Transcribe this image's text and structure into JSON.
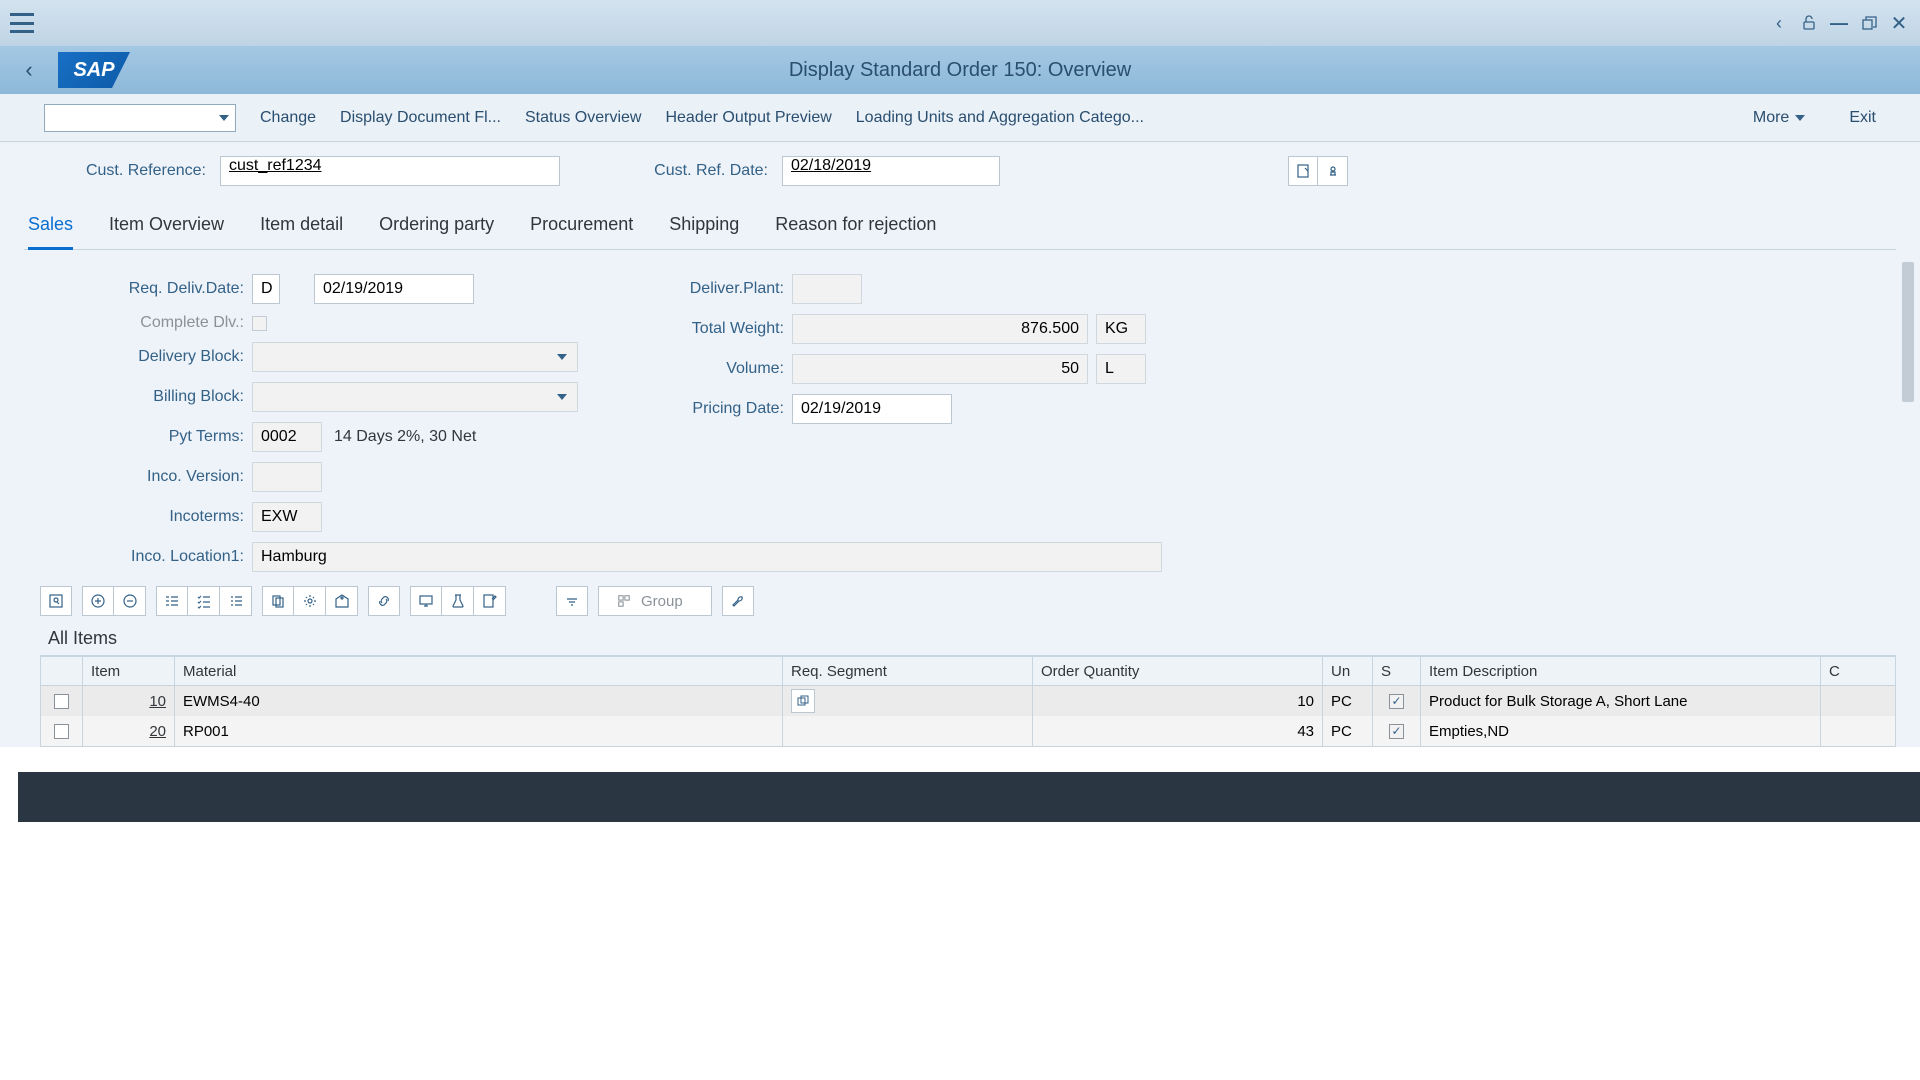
{
  "header": {
    "title": "Display Standard Order 150: Overview"
  },
  "actions": {
    "change": "Change",
    "docflow": "Display Document Fl...",
    "status": "Status Overview",
    "output": "Header Output Preview",
    "loading": "Loading Units and Aggregation Catego...",
    "more": "More",
    "exit": "Exit"
  },
  "cust": {
    "ref_label": "Cust. Reference:",
    "ref_value": "cust_ref1234",
    "date_label": "Cust. Ref. Date:",
    "date_value": "02/18/2019"
  },
  "tabs": {
    "sales": "Sales",
    "item_overview": "Item Overview",
    "item_detail": "Item detail",
    "ordering": "Ordering party",
    "procurement": "Procurement",
    "shipping": "Shipping",
    "rejection": "Reason for rejection"
  },
  "form": {
    "left": {
      "req_deliv_label": "Req. Deliv.Date:",
      "req_deliv_code": "D",
      "req_deliv_date": "02/19/2019",
      "complete_dlv_label": "Complete Dlv.:",
      "delivery_block_label": "Delivery Block:",
      "billing_block_label": "Billing Block:",
      "pyt_terms_label": "Pyt Terms:",
      "pyt_terms_code": "0002",
      "pyt_terms_desc": "14 Days 2%, 30 Net",
      "inco_version_label": "Inco. Version:",
      "incoterms_label": "Incoterms:",
      "incoterms_value": "EXW",
      "inco_loc_label": "Inco. Location1:",
      "inco_loc_value": "Hamburg"
    },
    "right": {
      "plant_label": "Deliver.Plant:",
      "weight_label": "Total Weight:",
      "weight_value": "876.500",
      "weight_unit": "KG",
      "volume_label": "Volume:",
      "volume_value": "50",
      "volume_unit": "L",
      "pricing_label": "Pricing Date:",
      "pricing_value": "02/19/2019"
    }
  },
  "toolbar": {
    "group_label": "Group"
  },
  "section": {
    "title": "All Items"
  },
  "table": {
    "headers": {
      "item": "Item",
      "material": "Material",
      "segment": "Req. Segment",
      "qty": "Order Quantity",
      "unit": "Un",
      "s": "S",
      "desc": "Item Description",
      "last": "C"
    },
    "rows": [
      {
        "item": "10",
        "material": "EWMS4-40",
        "qty": "10",
        "unit": "PC",
        "s": true,
        "desc": "Product for Bulk Storage A, Short Lane"
      },
      {
        "item": "20",
        "material": "RP001",
        "qty": "43",
        "unit": "PC",
        "s": true,
        "desc": "Empties,ND"
      }
    ]
  }
}
